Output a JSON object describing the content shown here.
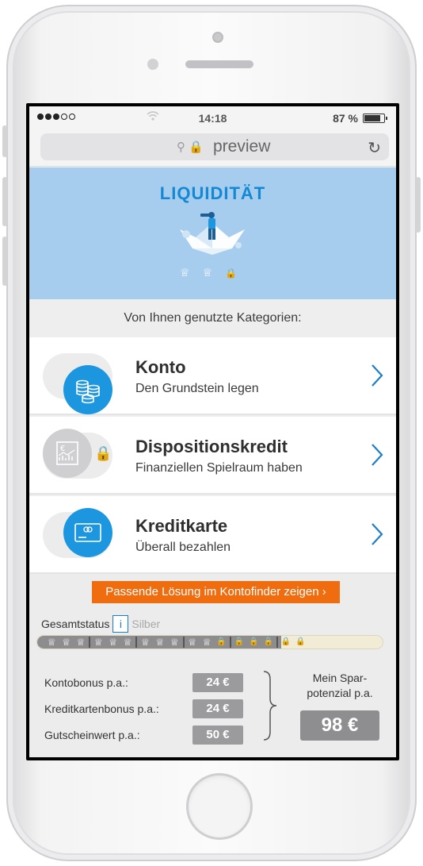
{
  "status_bar": {
    "time": "14:18",
    "battery": "87 %"
  },
  "browser": {
    "url": "preview"
  },
  "hero": {
    "title": "LIQUIDITÄT",
    "crowns": [
      "crown-icon",
      "crown-icon",
      "lock-icon"
    ]
  },
  "categories_header": "Von Ihnen genutzte Kategorien:",
  "categories": [
    {
      "title": "Konto",
      "subtitle": "Den Grundstein legen",
      "icon": "coins-icon",
      "active": true
    },
    {
      "title": "Dispositionskredit",
      "subtitle": "Finanziellen Spielraum haben",
      "icon": "euro-chart-icon",
      "active": false
    },
    {
      "title": "Kreditkarte",
      "subtitle": "Überall bezahlen",
      "icon": "credit-card-icon",
      "active": true
    }
  ],
  "cta": {
    "label": "Passende Lösung im Kontofinder zeigen ›"
  },
  "gesamtstatus": {
    "label": "Gesamtstatus",
    "info": "i",
    "value": "Silber",
    "crowns_earned": 11,
    "locks": 6
  },
  "bonus": [
    {
      "label": "Kontobonus p.a.:",
      "value": "24 €"
    },
    {
      "label": "Kreditkartenbonus p.a.:",
      "value": "24 €"
    },
    {
      "label": "Gutscheinwert p.a.:",
      "value": "50 €"
    }
  ],
  "spar": {
    "label_line1": "Mein Spar-",
    "label_line2": "potenzial p.a.",
    "value": "98 €"
  },
  "colors": {
    "accent_blue": "#1c97df",
    "hero_bg": "#a6cdee",
    "cta_orange": "#ef6c0f",
    "badge_grey": "#9b9b9d"
  }
}
